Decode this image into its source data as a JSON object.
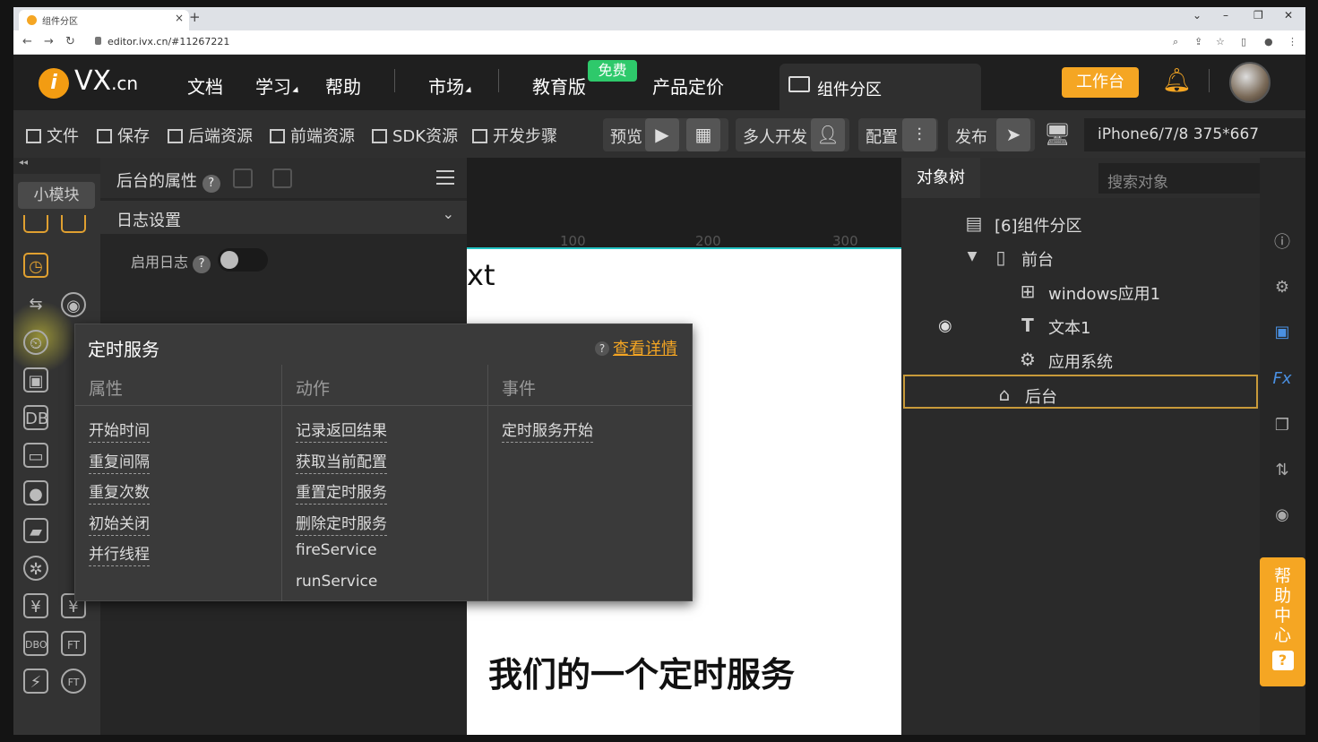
{
  "browser": {
    "tab_title": "组件分区",
    "url": "editor.ivx.cn/#11267221"
  },
  "header": {
    "logo_i": "i",
    "logo_main": "VX",
    "logo_suffix": ".cn",
    "nav": [
      "文档",
      "学习",
      "帮助",
      "市场",
      "教育版",
      "产品定价"
    ],
    "free_badge": "免费",
    "component_tab": "组件分区",
    "workbench": "工作台"
  },
  "toolbar": {
    "file": "文件",
    "save": "保存",
    "backend_res": "后端资源",
    "frontend_res": "前端资源",
    "sdk_res": "SDK资源",
    "dev_steps": "开发步骤",
    "preview": "预览",
    "multi_dev": "多人开发",
    "config": "配置",
    "publish": "发布",
    "device": "iPhone6/7/8 375*667"
  },
  "rail": {
    "small_block": "小模块",
    "collapse": "◂◂"
  },
  "props": {
    "title": "后台的属性",
    "section": "日志设置",
    "enable_log": "启用日志",
    "enable_log_value": false
  },
  "canvas": {
    "ruler": [
      "100",
      "200",
      "300"
    ],
    "partial_text": "xt",
    "caption": "我们的一个定时服务"
  },
  "popover": {
    "title": "定时服务",
    "help_link": "查看详情",
    "columns": [
      {
        "header": "属性",
        "items": [
          "开始时间",
          "重复间隔",
          "重复次数",
          "初始关闭",
          "并行线程"
        ]
      },
      {
        "header": "动作",
        "items": [
          "记录返回结果",
          "获取当前配置",
          "重置定时服务",
          "删除定时服务",
          "fireService",
          "runService"
        ]
      },
      {
        "header": "事件",
        "items": [
          "定时服务开始"
        ]
      }
    ]
  },
  "tree": {
    "tab": "对象树",
    "search_placeholder": "搜索对象",
    "nodes": [
      {
        "label": "[6]组件分区",
        "icon": "component-icon"
      },
      {
        "label": "前台",
        "icon": "phone-icon"
      },
      {
        "label": "windows应用1",
        "icon": "windows-exe-icon"
      },
      {
        "label": "文本1",
        "icon": "text-icon"
      },
      {
        "label": "应用系统",
        "icon": "gear-icon"
      },
      {
        "label": "后台",
        "icon": "backend-icon"
      }
    ]
  },
  "help_center": {
    "label_chars": [
      "帮",
      "助",
      "中",
      "心"
    ],
    "q": "?"
  }
}
